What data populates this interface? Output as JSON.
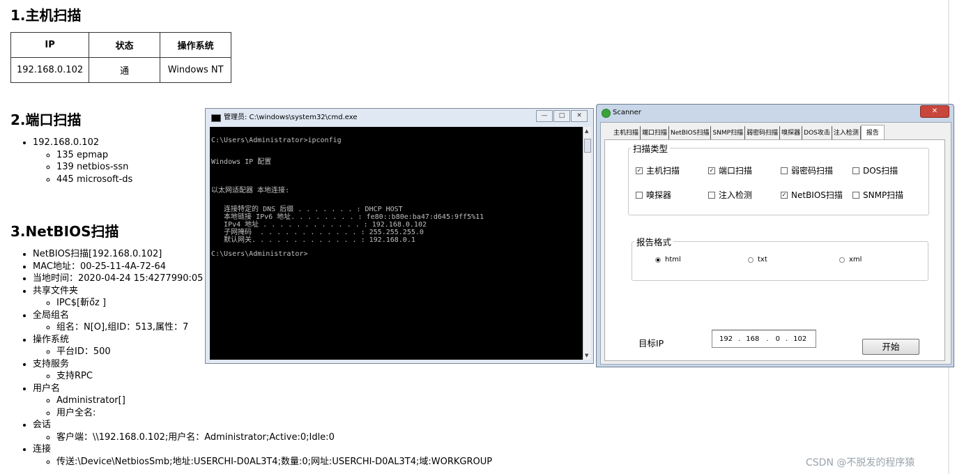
{
  "report": {
    "section1_title": "1.主机扫描",
    "host_table": {
      "headers": [
        "IP",
        "状态",
        "操作系统"
      ],
      "rows": [
        [
          "192.168.0.102",
          "通",
          "Windows NT"
        ]
      ]
    },
    "section2_title": "2.端口扫描",
    "port_scan": {
      "host": "192.168.0.102",
      "ports": [
        "135 epmap",
        "139 netbios-ssn",
        "445 microsoft-ds"
      ]
    },
    "section3_title": "3.NetBIOS扫描",
    "netbios": {
      "items": [
        {
          "text": "NetBIOS扫描[192.168.0.102]",
          "sub": []
        },
        {
          "text": "MAC地址：00-25-11-4A-72-64",
          "sub": []
        },
        {
          "text": "当地时间：2020-04-24 15:4277990:05",
          "sub": []
        },
        {
          "text": "共享文件夹",
          "sub": [
            "IPC$[斬ő̈z ]"
          ]
        },
        {
          "text": "全局组名",
          "sub": [
            "组名：N[O],组ID：513,属性：7"
          ]
        },
        {
          "text": "操作系统",
          "sub": [
            "平台ID：500"
          ]
        },
        {
          "text": "支持服务",
          "sub": [
            "支持RPC"
          ]
        },
        {
          "text": "用户名",
          "sub": [
            "Administrator[]",
            "用户全名:"
          ]
        },
        {
          "text": "会话",
          "sub": [
            "客户端：\\\\192.168.0.102;用户名：Administrator;Active:0;Idle:0"
          ]
        },
        {
          "text": "连接",
          "sub": [
            "传送:\\Device\\NetbiosSmb;地址:USERCHI-D0AL3T4;数量:0;网址:USERCHI-D0AL3T4;域:WORKGROUP"
          ]
        }
      ]
    }
  },
  "cmd_window": {
    "title": "管理员: C:\\windows\\system32\\cmd.exe",
    "buttons": [
      "—",
      "□",
      "✕"
    ],
    "lines": [
      "C:\\Users\\Administrator>ipconfig",
      "",
      "Windows IP 配置",
      "",
      "",
      "以太网适配器 本地连接:",
      "",
      "   连接特定的 DNS 后缀 . . . . . . . : DHCP HOST",
      "   本地链接 IPv6 地址. . . . . . . . : fe80::b80e:ba47:d645:9ff5%11",
      "   IPv4 地址 . . . . . . . . . . . . : 192.168.0.102",
      "   子网掩码  . . . . . . . . . . . . : 255.255.255.0",
      "   默认网关. . . . . . . . . . . . . : 192.168.0.1",
      "",
      "C:\\Users\\Administrator>"
    ]
  },
  "scanner_window": {
    "title": "Scanner",
    "close": "✕",
    "tabs": [
      "主机扫描",
      "端口扫描",
      "NetBIOS扫描",
      "SNMP扫描",
      "弱密码扫描",
      "嗅探器",
      "DOS攻击",
      "注入检测",
      "报告"
    ],
    "active_tab": "报告",
    "scan_type_legend": "扫描类型",
    "checkboxes": [
      {
        "label": "主机扫描",
        "checked": true
      },
      {
        "label": "端口扫描",
        "checked": true
      },
      {
        "label": "弱密码扫描",
        "checked": false
      },
      {
        "label": "DOS扫描",
        "checked": false
      },
      {
        "label": "嗅探器",
        "checked": false
      },
      {
        "label": "注入检测",
        "checked": false
      },
      {
        "label": "NetBIOS扫描",
        "checked": true
      },
      {
        "label": "SNMP扫描",
        "checked": false
      }
    ],
    "format_legend": "报告格式",
    "formats": [
      {
        "label": "html",
        "selected": true
      },
      {
        "label": "txt",
        "selected": false
      },
      {
        "label": "xml",
        "selected": false
      }
    ],
    "target_label": "目标IP",
    "ip_octets": [
      "192",
      "168",
      "0",
      "102"
    ],
    "start_button": "开始"
  },
  "watermark": "CSDN @不脱发的程序猿"
}
